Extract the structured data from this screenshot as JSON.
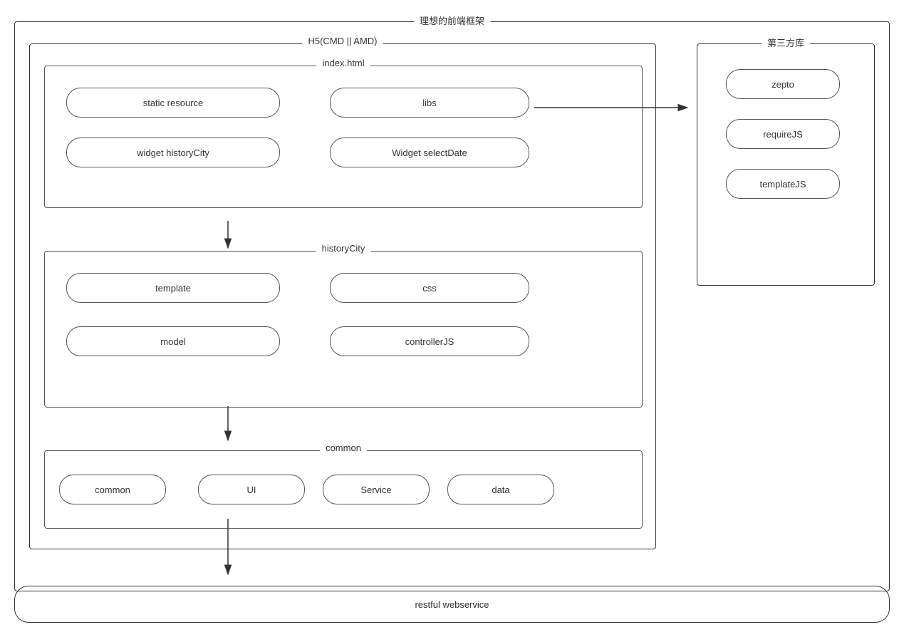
{
  "diagram": {
    "outer_title": "理想的前端框架",
    "h5_title": "H5(CMD || AMD)",
    "third_title": "第三方库",
    "index_title": "index.html",
    "history_title": "historyCity",
    "common_title": "common",
    "restful_label": "restful webservice",
    "pills": {
      "static_resource": "static resource",
      "libs": "libs",
      "widget_history": "widget historyCity",
      "widget_select": "Widget selectDate",
      "template": "template",
      "css": "css",
      "model": "model",
      "controllerjs": "controllerJS",
      "common": "common",
      "ui": "UI",
      "service": "Service",
      "data": "data",
      "zepto": "zepto",
      "requirejs": "requireJS",
      "templatejs": "templateJS"
    }
  }
}
